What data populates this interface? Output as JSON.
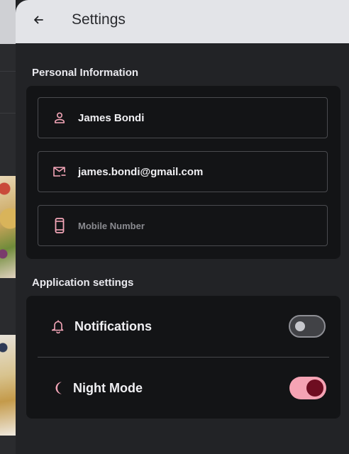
{
  "header": {
    "title": "Settings"
  },
  "personal": {
    "section_title": "Personal Information",
    "name": "James Bondi",
    "email": "james.bondi@gmail.com",
    "mobile_placeholder": "Mobile Number",
    "mobile_value": ""
  },
  "app_settings": {
    "section_title": "Application settings",
    "notifications": {
      "label": "Notifications",
      "enabled": false
    },
    "night_mode": {
      "label": "Night Mode",
      "enabled": true
    }
  },
  "colors": {
    "accent": "#f5a3b4",
    "toggle_knob_on": "#6e0d21",
    "icon_pink": "#f4a6b8"
  },
  "icons": [
    "arrow-left",
    "person",
    "mail",
    "smartphone",
    "bell",
    "moon"
  ]
}
